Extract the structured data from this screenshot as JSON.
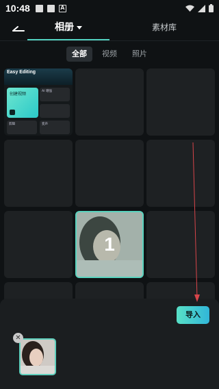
{
  "status_bar": {
    "time": "10:48",
    "notification_letter": "A"
  },
  "header": {
    "album_tab": "相册",
    "library_tab": "素材库"
  },
  "filters": [
    {
      "label": "全部",
      "active": true
    },
    {
      "label": "视频",
      "active": false
    },
    {
      "label": "照片",
      "active": false
    }
  ],
  "thumbnail_app": {
    "title": "Easy Editing",
    "card_label": "创建视频",
    "tiles": [
      "AI 增强",
      "",
      "剪辑",
      "变声",
      ""
    ]
  },
  "selected_cell": {
    "number": "1"
  },
  "bottom": {
    "import_label": "导入",
    "remove_symbol": "✕"
  },
  "colors": {
    "accent": "#58d3be",
    "background": "#0f1214",
    "cell": "#1e2123"
  },
  "icons": [
    "back-icon",
    "caret-down-icon",
    "close-icon",
    "wifi-icon",
    "signal-icon",
    "battery-icon"
  ]
}
